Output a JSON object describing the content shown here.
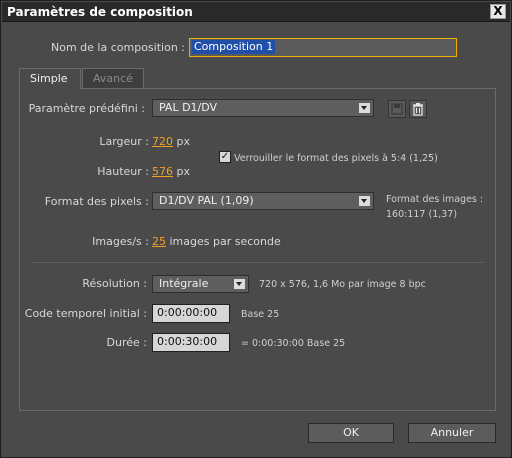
{
  "window": {
    "title": "Paramètres de composition",
    "close_label": "X"
  },
  "composition_name": {
    "label": "Nom de la composition :",
    "value": "Composition 1"
  },
  "tabs": [
    {
      "label": "Simple",
      "active": true
    },
    {
      "label": "Avancé",
      "active": false
    }
  ],
  "preset": {
    "label": "Paramètre prédéfini :",
    "value": "PAL D1/DV"
  },
  "width": {
    "label": "Largeur :",
    "value": "720",
    "unit": "px"
  },
  "height": {
    "label": "Hauteur :",
    "value": "576",
    "unit": "px"
  },
  "lock_ratio": {
    "label": "Verrouiller le format des pixels à 5:4 (1,25)",
    "checked": true,
    "mark": "✓"
  },
  "pixel_aspect": {
    "label": "Format des pixels :",
    "value": "D1/DV PAL (1,09)"
  },
  "frame_aspect": {
    "label": "Format des images :",
    "value": "160:117 (1,37)"
  },
  "frame_rate": {
    "label": "Images/s :",
    "value": "25",
    "unit": "images par seconde"
  },
  "resolution": {
    "label": "Résolution :",
    "value": "Intégrale",
    "info": "720 x 576, 1,6 Mo par image 8 bpc"
  },
  "start_timecode": {
    "label": "Code temporel initial :",
    "value": "0:00:00:00",
    "base": "Base 25"
  },
  "duration": {
    "label": "Durée :",
    "value": "0:00:30:00",
    "info": "= 0:00:30:00  Base 25"
  },
  "buttons": {
    "ok": "OK",
    "cancel": "Annuler"
  },
  "colors": {
    "accent": "#f0a020",
    "focus_border": "#f0b000",
    "selection": "#1f4fa8",
    "background": "#4a4a4a"
  }
}
